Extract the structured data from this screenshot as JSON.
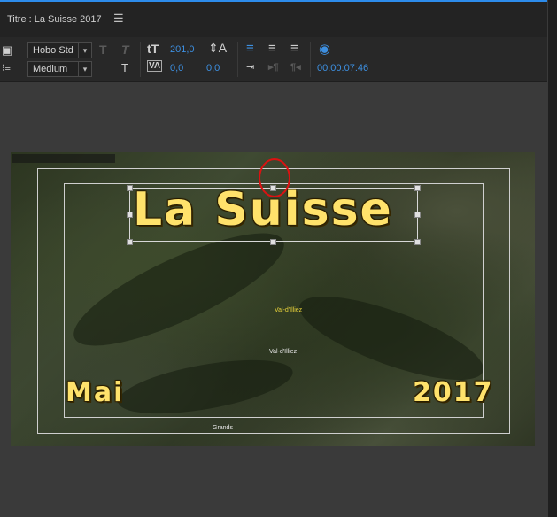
{
  "panel": {
    "title": "Titre : La Suisse 2017",
    "menu_icon": "hamburger-icon"
  },
  "toolbar": {
    "font_family": "Hobo Std",
    "font_style": "Medium",
    "font_size": "201,0",
    "kerning": "0,0",
    "leading": "0,0",
    "timecode": "00:00:07:46",
    "icons": [
      "text-frame-icon",
      "tab-stops-icon",
      "bold-t-icon",
      "italic-t-icon",
      "font-size-icon",
      "leading-icon",
      "kerning-icon",
      "underline-icon",
      "align-left-icon",
      "align-center-icon",
      "align-right-icon",
      "tab-icon",
      "show-video-icon"
    ]
  },
  "title_overlay": {
    "main": "La Suisse",
    "left": "Mai",
    "right": "2017"
  },
  "map_labels": {
    "town1": "Val-d'Illiez",
    "town2": "Val-d'Illiez",
    "town3": "Grands"
  },
  "colors": {
    "accent": "#2d8ceb",
    "title": "#ffe26b",
    "circle": "#dd1111"
  }
}
